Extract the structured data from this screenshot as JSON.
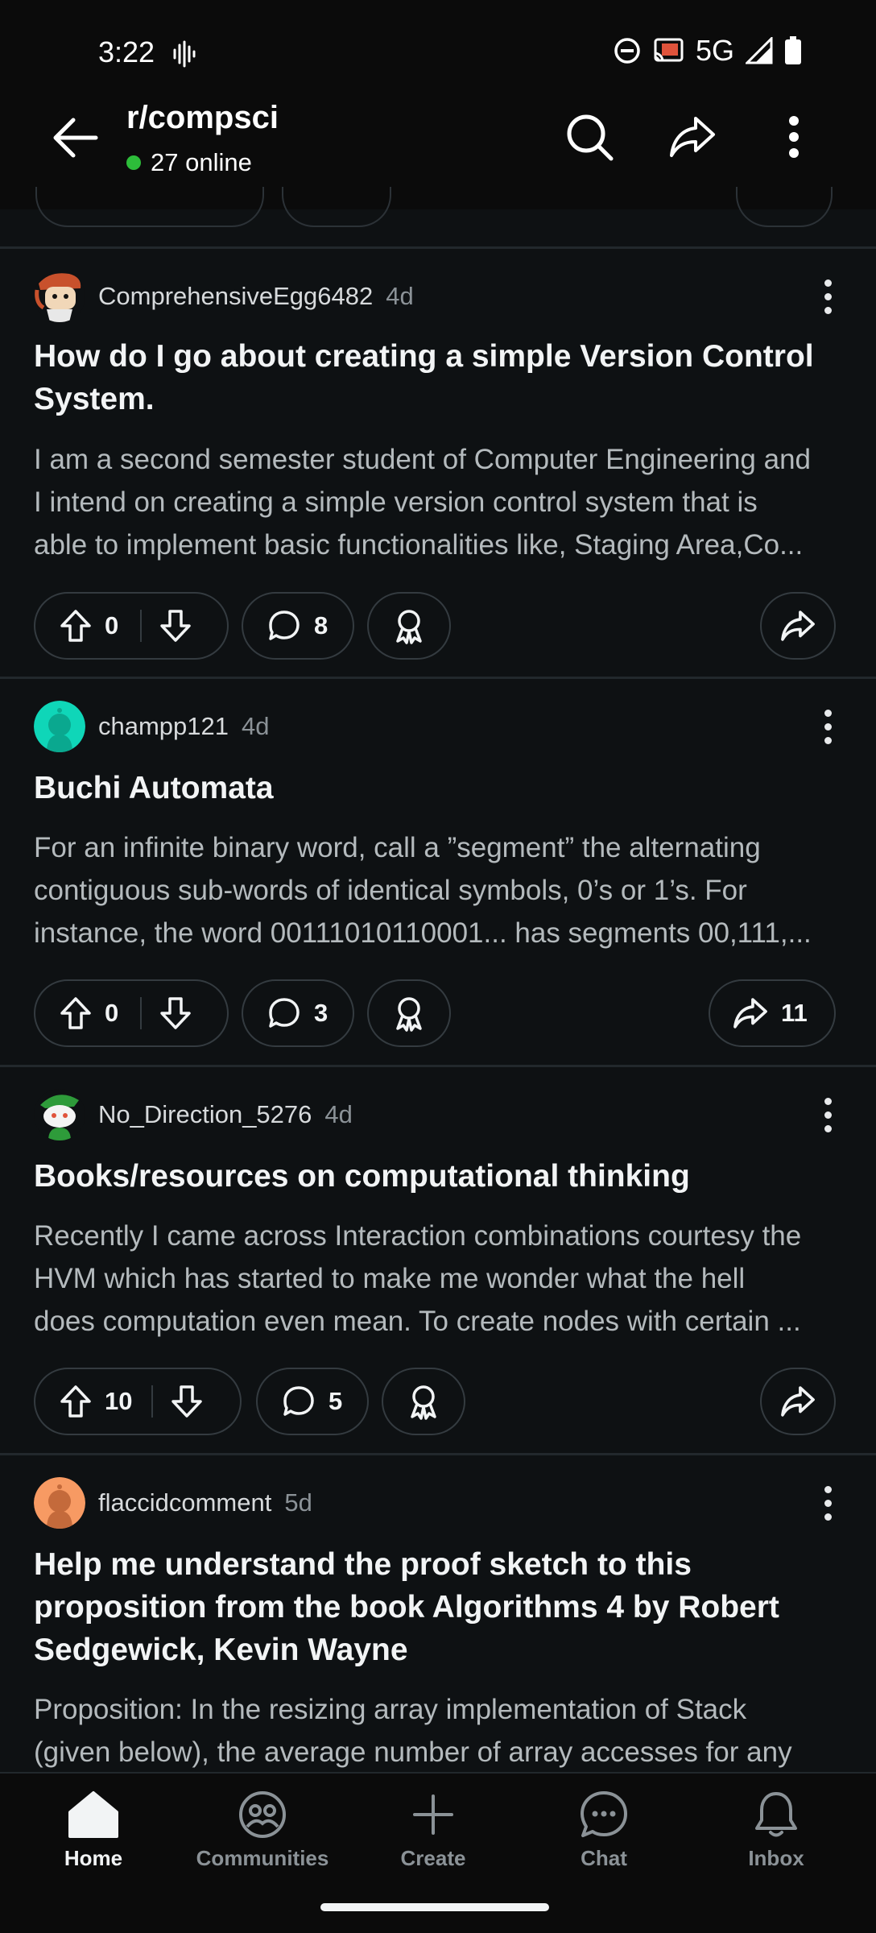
{
  "status_bar": {
    "time": "3:22",
    "network": "5G"
  },
  "header": {
    "subreddit": "r/compsci",
    "online": "27 online",
    "online_color": "#2dbd3a",
    "icons": [
      "back-arrow-icon",
      "search-icon",
      "share-icon",
      "more-vertical-icon"
    ]
  },
  "posts": [
    {
      "author": "ComprehensiveEgg6482",
      "age": "4d",
      "title_lines": [
        "How do I go about creating a simple Version Control",
        "System."
      ],
      "body_lines": [
        "I am a second semester student of Computer Engineering and",
        "I intend on creating a simple version control system that is",
        "able to implement basic functionalities like, Staging Area,Co..."
      ],
      "votes": "0",
      "comments": "8",
      "shares": ""
    },
    {
      "author": "champp121",
      "age": "4d",
      "title_lines": [
        "Buchi Automata"
      ],
      "body_lines": [
        "For an infinite binary word, call a ”segment” the alternating",
        "contiguous sub-words of identical symbols, 0’s or 1’s. For",
        "instance, the word 00111010110001... has segments 00,111,..."
      ],
      "votes": "0",
      "comments": "3",
      "shares": "11"
    },
    {
      "author": "No_Direction_5276",
      "age": "4d",
      "title_lines": [
        "Books/resources on computational thinking"
      ],
      "body_lines": [
        "Recently I came across Interaction combinations courtesy the",
        "HVM which has started to make me wonder what the hell",
        "does computation even mean. To create nodes with certain ..."
      ],
      "votes": "10",
      "comments": "5",
      "shares": ""
    },
    {
      "author": "flaccidcomment",
      "age": "5d",
      "title_lines": [
        "Help me understand the proof sketch to this",
        "proposition from the book Algorithms 4 by Robert",
        "Sedgewick, Kevin Wayne"
      ],
      "body_lines": [
        "Proposition: In the resizing array implementation of Stack",
        "(given below), the average number of array accesses for any"
      ]
    }
  ],
  "bottom_nav": {
    "items": [
      {
        "label": "Home",
        "icon": "home-icon",
        "active": true
      },
      {
        "label": "Communities",
        "icon": "communities-icon",
        "active": false
      },
      {
        "label": "Create",
        "icon": "plus-icon",
        "active": false
      },
      {
        "label": "Chat",
        "icon": "chat-icon",
        "active": false
      },
      {
        "label": "Inbox",
        "icon": "bell-icon",
        "active": false
      }
    ]
  }
}
